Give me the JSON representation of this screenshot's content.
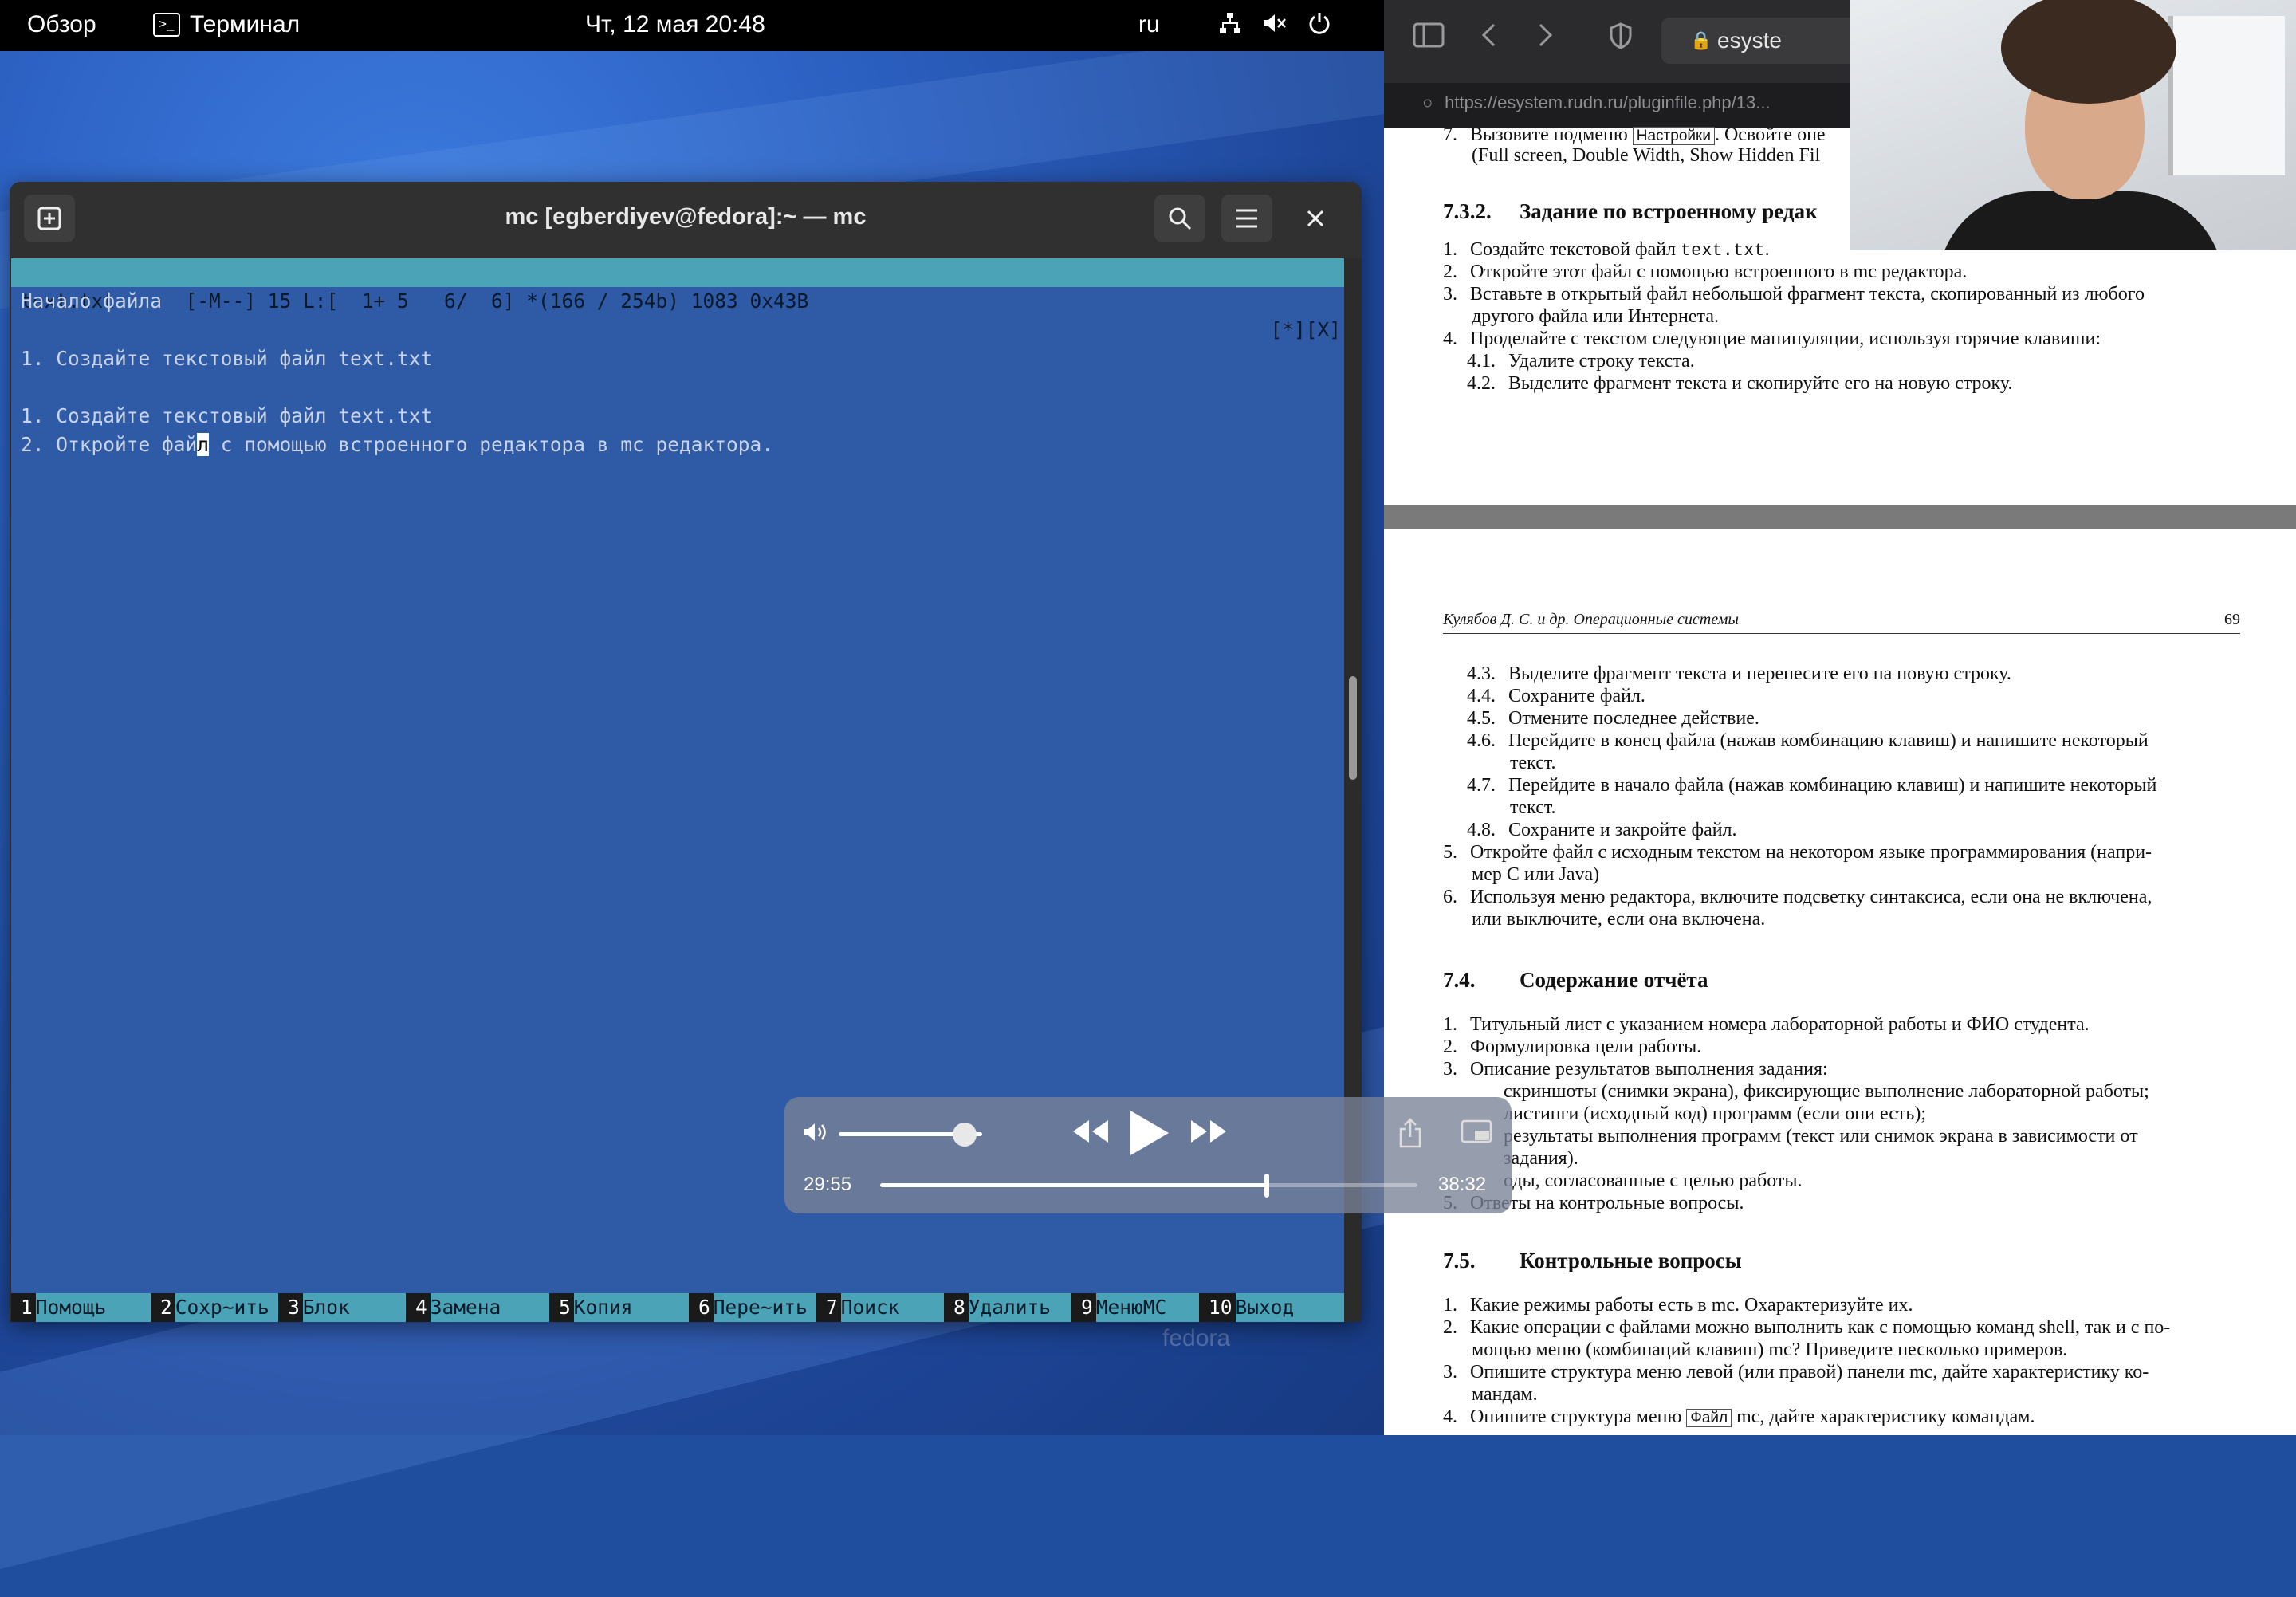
{
  "topbar": {
    "overview": "Обзор",
    "app": "Терминал",
    "clock": "Чт, 12 мая  20:48",
    "lang": "ru"
  },
  "terminal": {
    "title": "mc [egberdiyev@fedora]:~ — mc",
    "editor": {
      "status_left": "text.txt      [-M--] 15 L:[  1+ 5   6/  6] *(166 / 254b) 1083 0x43B",
      "status_right": "[*][X]",
      "lines": [
        "Начало файла",
        "",
        "1. Создайте текстовый файл text.txt",
        "",
        "1. Создайте текстовый файл text.txt"
      ],
      "line6_before": "2. Откройте фай",
      "line6_cursor": "л",
      "line6_after": " с помощью встроенного редактора в mc редактора.",
      "fkeys": [
        {
          "num": "1",
          "label": "Помощь"
        },
        {
          "num": "2",
          "label": "Сохр~ить"
        },
        {
          "num": "3",
          "label": "Блок"
        },
        {
          "num": "4",
          "label": "Замена"
        },
        {
          "num": "5",
          "label": "Копия"
        },
        {
          "num": "6",
          "label": "Пере~ить"
        },
        {
          "num": "7",
          "label": "Поиск"
        },
        {
          "num": "8",
          "label": "Удалить"
        },
        {
          "num": "9",
          "label": "МенюМС"
        },
        {
          "num": "10",
          "label": "Выход"
        }
      ]
    }
  },
  "desktop": {
    "watermark": "fedora"
  },
  "browser": {
    "address": "esyste",
    "tab_url": "https://esystem.rudn.ru/pluginfile.php/13...",
    "doc": {
      "item7_before": "Вызовите подменю",
      "item7_kbd": "Настройки",
      "item7_after": ". Освойте опе",
      "item7_cont": "(Full screen, Double Width, Show Hidden Fil",
      "h_732_num": "7.3.2.",
      "h_732": "Задание по встроенному редак",
      "t1": "Создайте текстовой файл",
      "t1_mono": "text.txt",
      "t2": "Откройте этот файл с помощью встроенного в mc редактора.",
      "t3": "Вставьте в открытый файл небольшой фрагмент текста, скопированный из любого",
      "t3_cont": "другого файла или Интернета.",
      "t4": "Проделайте с текстом следующие манипуляции, используя горячие клавиши:",
      "t41": "Удалите строку текста.",
      "t42": "Выделите фрагмент текста и скопируйте его на новую строку.",
      "running_head": "Кулябов Д. С. и др. Операционные системы",
      "page_no": "69",
      "t43": "Выделите фрагмент текста и перенесите его на новую строку.",
      "t44": "Сохраните файл.",
      "t45": "Отмените последнее действие.",
      "t46": "Перейдите в конец файла (нажав комбинацию клавиш) и напишите некоторый",
      "t46_cont": "текст.",
      "t47": "Перейдите в начало файла (нажав комбинацию клавиш) и напишите некоторый",
      "t47_cont": "текст.",
      "t48": "Сохраните и закройте файл.",
      "t5": "Откройте файл с исходным текстом на некотором языке программирования (напри-",
      "t5_cont": "мер C или Java)",
      "t6": "Используя меню редактора, включите подсветку синтаксиса, если она не включена,",
      "t6_cont": "или выключите, если она включена.",
      "h_74_num": "7.4.",
      "h_74": "Содержание отчёта",
      "r1": "Титульный лист с указанием номера лабораторной работы и ФИО студента.",
      "r2": "Формулировка цели работы.",
      "r3": "Описание результатов выполнения задания:",
      "r3a": "скриншоты (снимки экрана), фиксирующие выполнение лабораторной работы;",
      "r3b": "листинги (исходный код) программ (если они есть);",
      "r3c": "результаты выполнения программ (текст или снимок экрана в зависимости от",
      "r3c_cont": "задания).",
      "r4": "оды, согласованные с целью работы.",
      "r5": "Ответы на контрольные вопросы.",
      "h_75_num": "7.5.",
      "h_75": "Контрольные вопросы",
      "q1": "Какие режимы работы есть в mc. Охарактеризуйте их.",
      "q2": "Какие операции с файлами можно выполнить как с помощью команд shell, так и с по-",
      "q2_cont": "мощью меню (комбинаций клавиш) mc? Приведите несколько примеров.",
      "q3": "Опишите структура меню левой (или правой) панели mc, дайте характеристику ко-",
      "q3_cont": "мандам.",
      "q4_before": "Опишите структура меню",
      "q4_kbd": "Файл",
      "q4_after": "mc, дайте характеристику командам."
    }
  },
  "player": {
    "current_time": "29:55",
    "remaining_time": "38:32",
    "volume_fraction": 0.88,
    "progress_fraction": 0.72
  }
}
